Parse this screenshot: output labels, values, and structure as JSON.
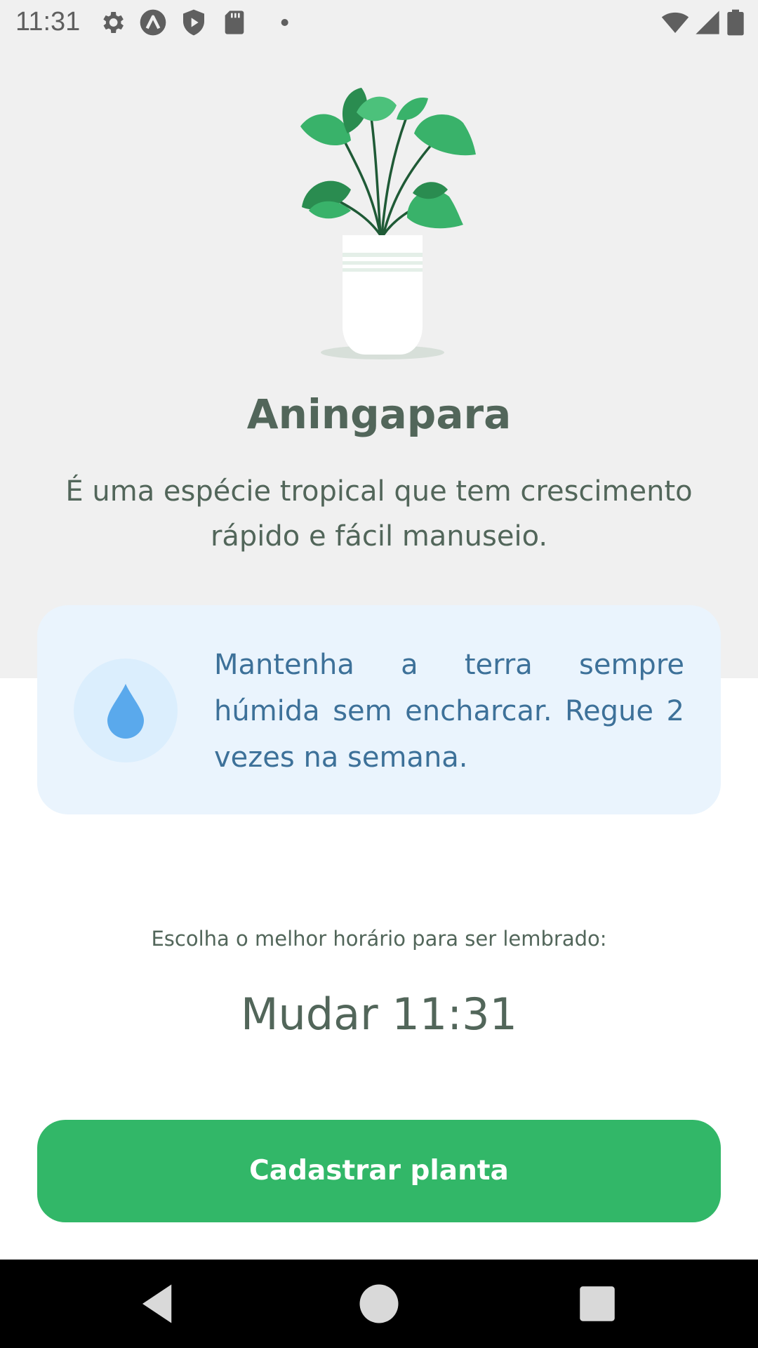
{
  "status_bar": {
    "time": "11:31",
    "left_icons": [
      "gear-icon",
      "app-logo-icon",
      "shield-play-icon",
      "sd-card-icon",
      "dot-icon"
    ],
    "right_icons": [
      "wifi-icon",
      "cell-signal-icon",
      "battery-icon"
    ]
  },
  "plant": {
    "name": "Aningapara",
    "about": "É uma espécie tropical que tem crescimento rápido e fácil manuseio."
  },
  "tip": {
    "icon": "water-drop-icon",
    "text": "Mantenha a terra sempre húmida sem encharcar. Regue 2 vezes na semana."
  },
  "reminder": {
    "label": "Escolha o melhor horário para ser lembrado:",
    "time_button_label": "Mudar 11:31"
  },
  "actions": {
    "submit_label": "Cadastrar planta"
  },
  "nav": {
    "icons": [
      "back-icon",
      "home-icon",
      "recents-icon"
    ]
  },
  "colors": {
    "accent_green": "#32b768",
    "heading": "#52665a",
    "tip_background": "#eaf4fd",
    "tip_text": "#3d7199",
    "drop_blue": "#5aa9ec",
    "top_background": "#f0f0f0"
  }
}
